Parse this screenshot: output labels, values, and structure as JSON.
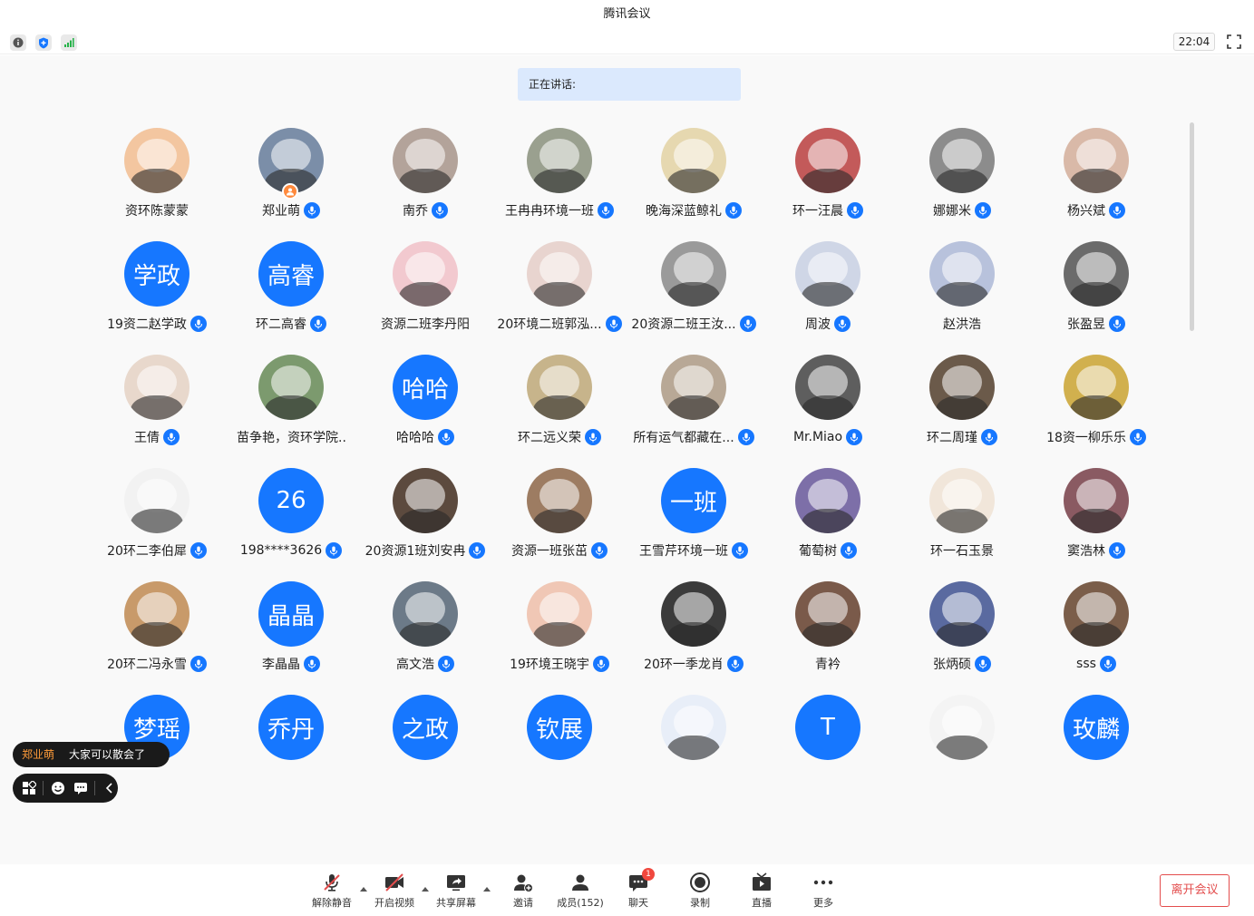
{
  "window": {
    "title": "腾讯会议"
  },
  "topbar": {
    "icons": [
      "info-icon",
      "shield-icon",
      "signal-icon"
    ],
    "clock": "22:04"
  },
  "speaking": {
    "label": "正在讲话:"
  },
  "participants": [
    {
      "name": "资环陈蒙蒙",
      "avatar_text": "",
      "color": "#f3c6a0",
      "mic": false
    },
    {
      "name": "郑业萌",
      "avatar_text": "",
      "color": "#7b8ea8",
      "mic": true,
      "host": true
    },
    {
      "name": "南乔",
      "avatar_text": "",
      "color": "#b3a39a",
      "mic": true
    },
    {
      "name": "王冉冉环境一班",
      "avatar_text": "",
      "color": "#9aa08f",
      "mic": true
    },
    {
      "name": "晚海深蓝鲸礼",
      "avatar_text": "",
      "color": "#e6d8b0",
      "mic": true
    },
    {
      "name": "环一汪晨",
      "avatar_text": "",
      "color": "#c35a5a",
      "mic": true
    },
    {
      "name": "娜娜米",
      "avatar_text": "",
      "color": "#8c8c8c",
      "mic": true
    },
    {
      "name": "杨兴斌",
      "avatar_text": "",
      "color": "#d9b9a8",
      "mic": true
    },
    {
      "name": "19资二赵学政",
      "avatar_text": "学政",
      "color": "#1677ff",
      "mic": true
    },
    {
      "name": "环二高睿",
      "avatar_text": "高睿",
      "color": "#1677ff",
      "mic": true
    },
    {
      "name": "资源二班李丹阳",
      "avatar_text": "",
      "color": "#f2c9cf",
      "mic": false
    },
    {
      "name": "20环境二班郭泓...",
      "avatar_text": "",
      "color": "#e8d4cf",
      "mic": true
    },
    {
      "name": "20资源二班王汝...",
      "avatar_text": "",
      "color": "#9a9a9a",
      "mic": true
    },
    {
      "name": "周波",
      "avatar_text": "",
      "color": "#cfd6e6",
      "mic": true
    },
    {
      "name": "赵洪浩",
      "avatar_text": "",
      "color": "#b8c2dc",
      "mic": false
    },
    {
      "name": "张盈昱",
      "avatar_text": "",
      "color": "#6b6b6b",
      "mic": true
    },
    {
      "name": "王倩",
      "avatar_text": "",
      "color": "#e8d8cc",
      "mic": true
    },
    {
      "name": "苗争艳，资环学院...",
      "avatar_text": "",
      "color": "#7c9a6e",
      "mic": false
    },
    {
      "name": "哈哈哈",
      "avatar_text": "哈哈",
      "color": "#1677ff",
      "mic": true
    },
    {
      "name": "环二远义荣",
      "avatar_text": "",
      "color": "#c7b48b",
      "mic": true
    },
    {
      "name": "所有运气都藏在...",
      "avatar_text": "",
      "color": "#b8a896",
      "mic": true
    },
    {
      "name": "Mr.Miao",
      "avatar_text": "",
      "color": "#5e5e5e",
      "mic": true
    },
    {
      "name": "环二周瑾",
      "avatar_text": "",
      "color": "#6b5a4a",
      "mic": true
    },
    {
      "name": "18资一柳乐乐",
      "avatar_text": "",
      "color": "#d1b04e",
      "mic": true
    },
    {
      "name": "20环二李伯犀",
      "avatar_text": "",
      "color": "#f2f2f2",
      "mic": true
    },
    {
      "name": "198****3626",
      "avatar_text": "26",
      "color": "#1677ff",
      "mic": true
    },
    {
      "name": "20资源1班刘安冉",
      "avatar_text": "",
      "color": "#5c4a3e",
      "mic": true
    },
    {
      "name": "资源一班张茁",
      "avatar_text": "",
      "color": "#9d7c62",
      "mic": true
    },
    {
      "name": "王雪芹环境一班",
      "avatar_text": "一班",
      "color": "#1677ff",
      "mic": true
    },
    {
      "name": "葡萄树",
      "avatar_text": "",
      "color": "#7d6fa8",
      "mic": true
    },
    {
      "name": "环一石玉景",
      "avatar_text": "",
      "color": "#f1e6da",
      "mic": false
    },
    {
      "name": "窦浩林",
      "avatar_text": "",
      "color": "#8a5a62",
      "mic": true
    },
    {
      "name": "20环二冯永雪",
      "avatar_text": "",
      "color": "#c89a6a",
      "mic": true
    },
    {
      "name": "李晶晶",
      "avatar_text": "晶晶",
      "color": "#1677ff",
      "mic": true
    },
    {
      "name": "高文浩",
      "avatar_text": "",
      "color": "#6c7a88",
      "mic": true
    },
    {
      "name": "19环境王晓宇",
      "avatar_text": "",
      "color": "#f0c7b5",
      "mic": true
    },
    {
      "name": "20环一季龙肖",
      "avatar_text": "",
      "color": "#3b3b3b",
      "mic": true
    },
    {
      "name": "青衿",
      "avatar_text": "",
      "color": "#7a5a4a",
      "mic": false
    },
    {
      "name": "张炳硕",
      "avatar_text": "",
      "color": "#5a6aa0",
      "mic": true
    },
    {
      "name": "sss",
      "avatar_text": "",
      "color": "#7b5e4a",
      "mic": true
    },
    {
      "name": "",
      "avatar_text": "梦瑶",
      "color": "#1677ff",
      "mic": false
    },
    {
      "name": "",
      "avatar_text": "乔丹",
      "color": "#1677ff",
      "mic": false
    },
    {
      "name": "",
      "avatar_text": "之政",
      "color": "#1677ff",
      "mic": false
    },
    {
      "name": "",
      "avatar_text": "钦展",
      "color": "#1677ff",
      "mic": false
    },
    {
      "name": "",
      "avatar_text": "",
      "color": "#e8eef8",
      "mic": false
    },
    {
      "name": "",
      "avatar_text": "T",
      "color": "#1677ff",
      "mic": false
    },
    {
      "name": "",
      "avatar_text": "",
      "color": "#f4f4f4",
      "mic": false
    },
    {
      "name": "",
      "avatar_text": "玫麟",
      "color": "#1677ff",
      "mic": false
    }
  ],
  "chat_popup": {
    "sender": "郑业萌",
    "message": "大家可以散会了"
  },
  "bottombar": {
    "unmute": "解除静音",
    "video": "开启视频",
    "share": "共享屏幕",
    "invite": "邀请",
    "members": "成员(152)",
    "chat": "聊天",
    "chat_badge": "1",
    "record": "录制",
    "live": "直播",
    "more": "更多",
    "leave": "离开会议"
  },
  "colors": {
    "accent": "#1677ff",
    "leave": "#e34d4d",
    "host": "#ff8a3d"
  }
}
